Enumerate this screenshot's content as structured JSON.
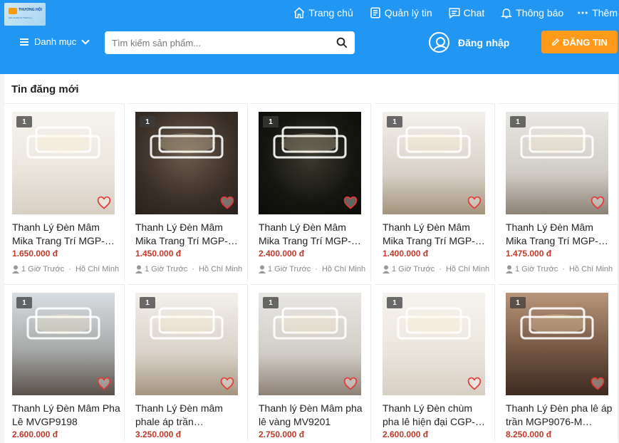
{
  "header": {
    "logo": {
      "name": "THƯƠNG HỘI",
      "tagline": "Siêu thị Đồ Cũ Thanh Lý"
    },
    "nav": [
      {
        "label": "Trang chủ",
        "icon": "home-icon"
      },
      {
        "label": "Quản lý tin",
        "icon": "list-icon"
      },
      {
        "label": "Chat",
        "icon": "chat-icon"
      },
      {
        "label": "Thông báo",
        "icon": "bell-icon"
      },
      {
        "label": "Thêm",
        "icon": "more-dots-icon"
      }
    ],
    "category_label": "Danh mục",
    "search_placeholder": "Tìm kiếm sản phẩm...",
    "login_label": "Đăng nhập",
    "post_button": "ĐĂNG TIN"
  },
  "colors": {
    "header": "#2196f3",
    "post_button": "#ff9a1a",
    "price": "#c0392b"
  },
  "section": {
    "title": "Tin đăng mới",
    "listings": [
      {
        "title": "Thanh Lý Đèn Mâm Mika Trang Trí MGP-…",
        "price": "1.650.000 đ",
        "time": "1 Giờ Trước",
        "location": "Hồ Chí Minh",
        "image_count": "1",
        "thumb": "img-room"
      },
      {
        "title": "Thanh Lý Đèn Mâm Mika Trang Trí MGP-…",
        "price": "1.450.000 đ",
        "time": "1 Giờ Trước",
        "location": "Hồ Chí Minh",
        "image_count": "1",
        "thumb": "img-dark"
      },
      {
        "title": "Thanh Lý Đèn Mâm Mika Trang Trí MGP-…",
        "price": "2.400.000 đ",
        "time": "1 Giờ Trước",
        "location": "Hồ Chí Minh",
        "image_count": "1",
        "thumb": "img-black"
      },
      {
        "title": "Thanh Lý Đèn Mâm Mika Trang Trí MGP-…",
        "price": "1.400.000 đ",
        "time": "1 Giờ Trước",
        "location": "Hồ Chí Minh",
        "image_count": "1",
        "thumb": "img-interior"
      },
      {
        "title": "Thanh Lý Đèn Mâm Mika Trang Trí MGP-…",
        "price": "1.475.000 đ",
        "time": "1 Giờ Trước",
        "location": "Hồ Chí Minh",
        "image_count": "1",
        "thumb": "img-grey"
      },
      {
        "title": "Thanh Lý Đèn Mâm Pha Lê MVGP9198",
        "price": "2.600.000 đ",
        "time": "",
        "location": "",
        "image_count": "1",
        "thumb": "img-wood"
      },
      {
        "title": "Thanh Lý Đèn mâm phale áp trần…",
        "price": "3.250.000 đ",
        "time": "",
        "location": "",
        "image_count": "1",
        "thumb": "img-interior"
      },
      {
        "title": "Thanh lý Đèn Mâm pha lê vàng MV9201",
        "price": "2.750.000 đ",
        "time": "",
        "location": "",
        "image_count": "1",
        "thumb": "img-grey"
      },
      {
        "title": "Thanh Lý Đèn chùm pha lê hiện đại CGP-…",
        "price": "2.600.000 đ",
        "time": "",
        "location": "",
        "image_count": "1",
        "thumb": "img-room"
      },
      {
        "title": "Thanh Lý Đèn pha lê áp trần MGP9076-M…",
        "price": "8.250.000 đ",
        "time": "",
        "location": "",
        "image_count": "1",
        "thumb": "img-gold"
      }
    ]
  }
}
